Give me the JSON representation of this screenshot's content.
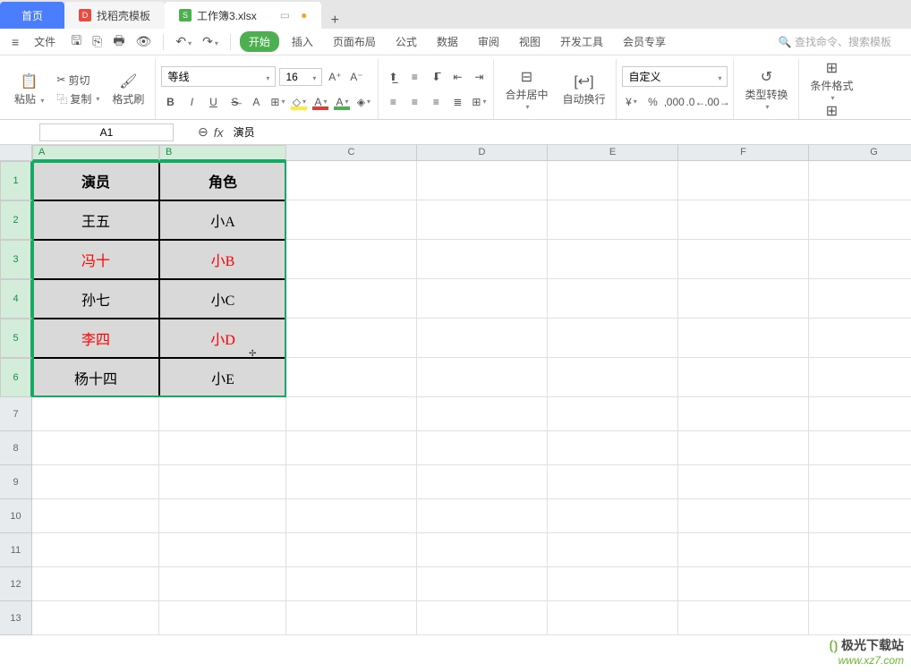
{
  "tabs": {
    "home": "首页",
    "template": "找稻壳模板",
    "active": "工作簿3.xlsx",
    "new": "+"
  },
  "menu": {
    "file_label": "文件",
    "start": "开始",
    "items": [
      "插入",
      "页面布局",
      "公式",
      "数据",
      "审阅",
      "视图",
      "开发工具",
      "会员专享"
    ],
    "search_placeholder": "查找命令、搜索模板"
  },
  "ribbon": {
    "paste": "粘贴",
    "cut": "剪切",
    "copy": "复制",
    "format_painter": "格式刷",
    "font_name": "等线",
    "font_size": "16",
    "merge": "合并居中",
    "wrap": "自动换行",
    "num_format": "自定义",
    "type_convert": "类型转换",
    "cond_format": "条件格式"
  },
  "formula_bar": {
    "cell_ref": "A1",
    "value": "演员"
  },
  "grid": {
    "col_width_data": 142,
    "col_width_rest": 146,
    "row_h_data": 44,
    "row_h_rest": 38,
    "cols": [
      "A",
      "B",
      "C",
      "D",
      "E",
      "F",
      "G"
    ],
    "row_nums": [
      "1",
      "2",
      "3",
      "4",
      "5",
      "6",
      "7",
      "8",
      "9",
      "10",
      "11",
      "12",
      "13"
    ],
    "headers": [
      "演员",
      "角色"
    ],
    "rows": [
      {
        "a": "王五",
        "b": "小A",
        "red": false
      },
      {
        "a": "冯十",
        "b": "小B",
        "red": true
      },
      {
        "a": "孙七",
        "b": "小C",
        "red": false
      },
      {
        "a": "李四",
        "b": "小D",
        "red": true
      },
      {
        "a": "杨十四",
        "b": "小E",
        "red": false
      }
    ]
  },
  "watermark": {
    "name": "极光下载站",
    "url": "www.xz7.com"
  }
}
